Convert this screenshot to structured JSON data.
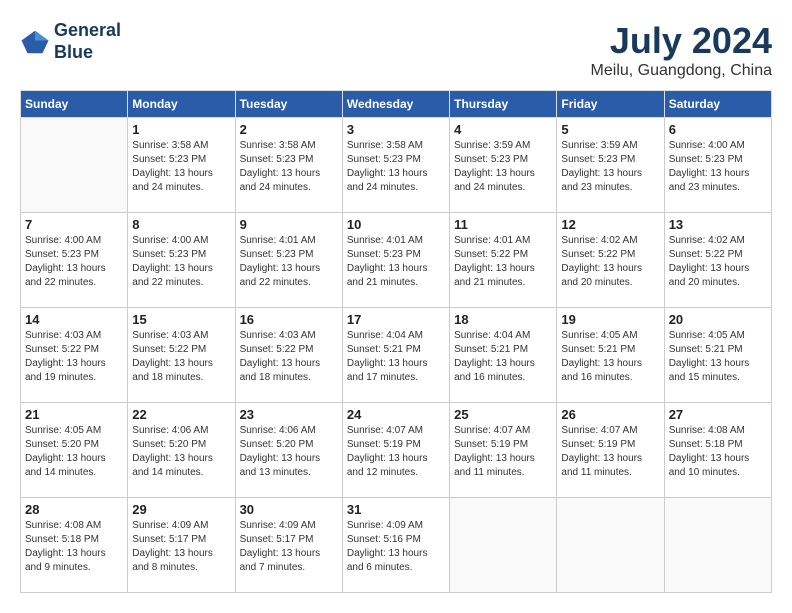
{
  "header": {
    "logo_line1": "General",
    "logo_line2": "Blue",
    "month_year": "July 2024",
    "location": "Meilu, Guangdong, China"
  },
  "weekdays": [
    "Sunday",
    "Monday",
    "Tuesday",
    "Wednesday",
    "Thursday",
    "Friday",
    "Saturday"
  ],
  "weeks": [
    [
      {
        "day": "",
        "info": ""
      },
      {
        "day": "1",
        "info": "Sunrise: 3:58 AM\nSunset: 5:23 PM\nDaylight: 13 hours\nand 24 minutes."
      },
      {
        "day": "2",
        "info": "Sunrise: 3:58 AM\nSunset: 5:23 PM\nDaylight: 13 hours\nand 24 minutes."
      },
      {
        "day": "3",
        "info": "Sunrise: 3:58 AM\nSunset: 5:23 PM\nDaylight: 13 hours\nand 24 minutes."
      },
      {
        "day": "4",
        "info": "Sunrise: 3:59 AM\nSunset: 5:23 PM\nDaylight: 13 hours\nand 24 minutes."
      },
      {
        "day": "5",
        "info": "Sunrise: 3:59 AM\nSunset: 5:23 PM\nDaylight: 13 hours\nand 23 minutes."
      },
      {
        "day": "6",
        "info": "Sunrise: 4:00 AM\nSunset: 5:23 PM\nDaylight: 13 hours\nand 23 minutes."
      }
    ],
    [
      {
        "day": "7",
        "info": "Sunrise: 4:00 AM\nSunset: 5:23 PM\nDaylight: 13 hours\nand 22 minutes."
      },
      {
        "day": "8",
        "info": "Sunrise: 4:00 AM\nSunset: 5:23 PM\nDaylight: 13 hours\nand 22 minutes."
      },
      {
        "day": "9",
        "info": "Sunrise: 4:01 AM\nSunset: 5:23 PM\nDaylight: 13 hours\nand 22 minutes."
      },
      {
        "day": "10",
        "info": "Sunrise: 4:01 AM\nSunset: 5:23 PM\nDaylight: 13 hours\nand 21 minutes."
      },
      {
        "day": "11",
        "info": "Sunrise: 4:01 AM\nSunset: 5:22 PM\nDaylight: 13 hours\nand 21 minutes."
      },
      {
        "day": "12",
        "info": "Sunrise: 4:02 AM\nSunset: 5:22 PM\nDaylight: 13 hours\nand 20 minutes."
      },
      {
        "day": "13",
        "info": "Sunrise: 4:02 AM\nSunset: 5:22 PM\nDaylight: 13 hours\nand 20 minutes."
      }
    ],
    [
      {
        "day": "14",
        "info": "Sunrise: 4:03 AM\nSunset: 5:22 PM\nDaylight: 13 hours\nand 19 minutes."
      },
      {
        "day": "15",
        "info": "Sunrise: 4:03 AM\nSunset: 5:22 PM\nDaylight: 13 hours\nand 18 minutes."
      },
      {
        "day": "16",
        "info": "Sunrise: 4:03 AM\nSunset: 5:22 PM\nDaylight: 13 hours\nand 18 minutes."
      },
      {
        "day": "17",
        "info": "Sunrise: 4:04 AM\nSunset: 5:21 PM\nDaylight: 13 hours\nand 17 minutes."
      },
      {
        "day": "18",
        "info": "Sunrise: 4:04 AM\nSunset: 5:21 PM\nDaylight: 13 hours\nand 16 minutes."
      },
      {
        "day": "19",
        "info": "Sunrise: 4:05 AM\nSunset: 5:21 PM\nDaylight: 13 hours\nand 16 minutes."
      },
      {
        "day": "20",
        "info": "Sunrise: 4:05 AM\nSunset: 5:21 PM\nDaylight: 13 hours\nand 15 minutes."
      }
    ],
    [
      {
        "day": "21",
        "info": "Sunrise: 4:05 AM\nSunset: 5:20 PM\nDaylight: 13 hours\nand 14 minutes."
      },
      {
        "day": "22",
        "info": "Sunrise: 4:06 AM\nSunset: 5:20 PM\nDaylight: 13 hours\nand 14 minutes."
      },
      {
        "day": "23",
        "info": "Sunrise: 4:06 AM\nSunset: 5:20 PM\nDaylight: 13 hours\nand 13 minutes."
      },
      {
        "day": "24",
        "info": "Sunrise: 4:07 AM\nSunset: 5:19 PM\nDaylight: 13 hours\nand 12 minutes."
      },
      {
        "day": "25",
        "info": "Sunrise: 4:07 AM\nSunset: 5:19 PM\nDaylight: 13 hours\nand 11 minutes."
      },
      {
        "day": "26",
        "info": "Sunrise: 4:07 AM\nSunset: 5:19 PM\nDaylight: 13 hours\nand 11 minutes."
      },
      {
        "day": "27",
        "info": "Sunrise: 4:08 AM\nSunset: 5:18 PM\nDaylight: 13 hours\nand 10 minutes."
      }
    ],
    [
      {
        "day": "28",
        "info": "Sunrise: 4:08 AM\nSunset: 5:18 PM\nDaylight: 13 hours\nand 9 minutes."
      },
      {
        "day": "29",
        "info": "Sunrise: 4:09 AM\nSunset: 5:17 PM\nDaylight: 13 hours\nand 8 minutes."
      },
      {
        "day": "30",
        "info": "Sunrise: 4:09 AM\nSunset: 5:17 PM\nDaylight: 13 hours\nand 7 minutes."
      },
      {
        "day": "31",
        "info": "Sunrise: 4:09 AM\nSunset: 5:16 PM\nDaylight: 13 hours\nand 6 minutes."
      },
      {
        "day": "",
        "info": ""
      },
      {
        "day": "",
        "info": ""
      },
      {
        "day": "",
        "info": ""
      }
    ]
  ]
}
